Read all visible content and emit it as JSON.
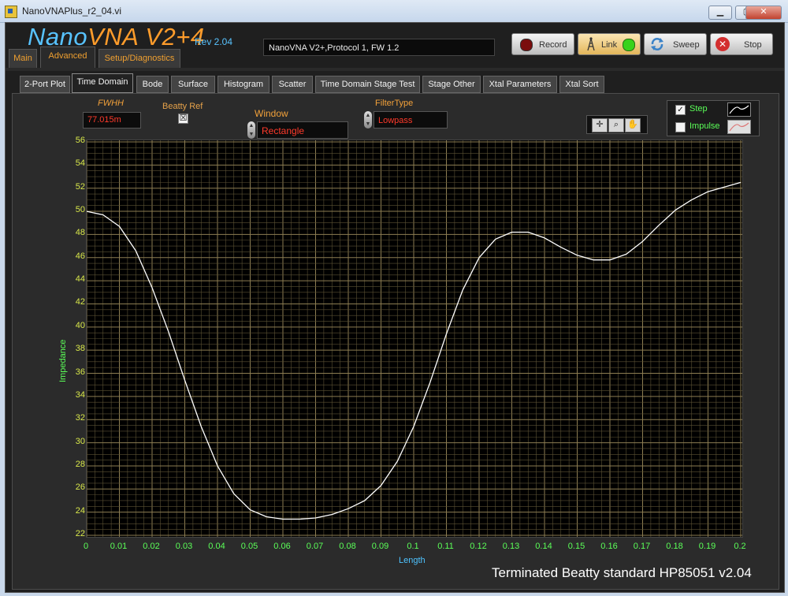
{
  "window": {
    "title": "NanoVNAPlus_r2_04.vi",
    "minimize": "▁",
    "maximize": "▢",
    "close": "✕"
  },
  "header": {
    "logo_nano": "Nano",
    "logo_vna": "VNA V2+4",
    "rev": "Rev 2.04",
    "status": "NanoVNA V2+,Protocol 1, FW 1.2"
  },
  "toolbar": {
    "record": "Record",
    "link": "Link",
    "sweep": "Sweep",
    "stop": "Stop",
    "link_led_color": "#39d21b",
    "record_led_color": "#7a0d0d"
  },
  "top_tabs": [
    "Main",
    "Advanced",
    "Setup/Diagnostics"
  ],
  "sub_tabs": [
    "2-Port Plot",
    "Time Domain",
    "Bode",
    "Surface",
    "Histogram",
    "Scatter",
    "Time Domain Stage Test",
    "Stage Other",
    "Xtal Parameters",
    "Xtal Sort"
  ],
  "controls": {
    "fwhh_label": "FWHH",
    "fwhh_value": "77.015m",
    "beatty_label": "Beatty Ref",
    "beatty_checked": "☒",
    "window_label": "Window",
    "window_value": "Rectangle",
    "filter_label": "FilterType",
    "filter_value": "Lowpass"
  },
  "legend": {
    "step_label": "Step",
    "step_checked": "✓",
    "impulse_label": "Impulse"
  },
  "footer": "Terminated Beatty standard HP85051 v2.04",
  "chart_data": {
    "type": "line",
    "xlabel": "Length",
    "ylabel": "Impedance",
    "xlim": [
      0,
      0.2
    ],
    "ylim": [
      22,
      56
    ],
    "x_ticks": [
      "0",
      "0.01",
      "0.02",
      "0.03",
      "0.04",
      "0.05",
      "0.06",
      "0.07",
      "0.08",
      "0.09",
      "0.1",
      "0.11",
      "0.12",
      "0.13",
      "0.14",
      "0.15",
      "0.16",
      "0.17",
      "0.18",
      "0.19",
      "0.2"
    ],
    "y_ticks": [
      "56",
      "54",
      "52",
      "50",
      "48",
      "46",
      "44",
      "42",
      "40",
      "38",
      "36",
      "34",
      "32",
      "30",
      "28",
      "26",
      "24",
      "22"
    ],
    "grid": true,
    "series": [
      {
        "color": "#ffffff",
        "x": [
          0,
          0.005,
          0.01,
          0.015,
          0.02,
          0.025,
          0.03,
          0.035,
          0.04,
          0.045,
          0.05,
          0.055,
          0.06,
          0.065,
          0.07,
          0.075,
          0.08,
          0.085,
          0.09,
          0.095,
          0.1,
          0.105,
          0.11,
          0.115,
          0.12,
          0.125,
          0.13,
          0.135,
          0.14,
          0.145,
          0.15,
          0.155,
          0.16,
          0.165,
          0.17,
          0.175,
          0.18,
          0.185,
          0.19,
          0.195,
          0.2
        ],
        "y": [
          50.0,
          49.7,
          48.7,
          46.6,
          43.4,
          39.6,
          35.4,
          31.4,
          28.0,
          25.6,
          24.2,
          23.6,
          23.4,
          23.4,
          23.5,
          23.8,
          24.3,
          25.0,
          26.3,
          28.4,
          31.4,
          35.2,
          39.4,
          43.2,
          46.0,
          47.6,
          48.2,
          48.2,
          47.7,
          46.9,
          46.2,
          45.8,
          45.8,
          46.3,
          47.4,
          48.8,
          50.1,
          51.0,
          51.7,
          52.1,
          52.5
        ]
      }
    ]
  }
}
